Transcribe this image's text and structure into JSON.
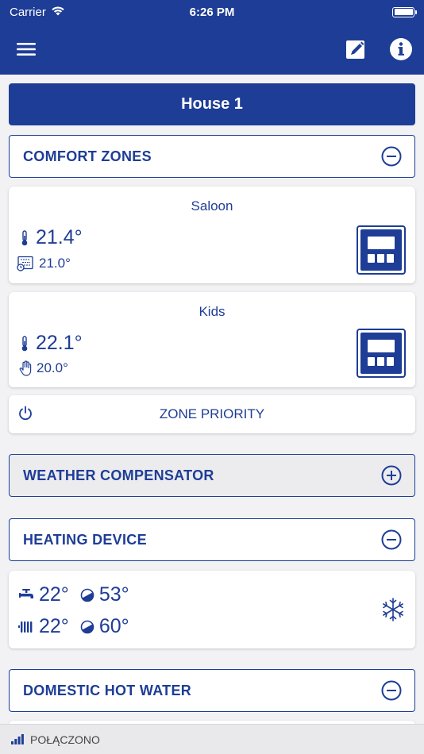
{
  "status_bar": {
    "carrier": "Carrier",
    "time": "6:26 PM"
  },
  "colors": {
    "primary": "#1e3d96",
    "background": "#f2f2f4",
    "card": "#ffffff"
  },
  "house": {
    "title": "House 1"
  },
  "comfort_zones": {
    "label": "COMFORT ZONES",
    "expanded": true,
    "zones": [
      {
        "name": "Saloon",
        "temperature": "21.4°",
        "setpoint": "21.0°",
        "mode_icon": "schedule-icon"
      },
      {
        "name": "Kids",
        "temperature": "22.1°",
        "setpoint": "20.0°",
        "mode_icon": "hand-icon"
      }
    ],
    "priority_label": "ZONE PRIORITY"
  },
  "weather_compensator": {
    "label": "WEATHER COMPENSATOR",
    "expanded": false
  },
  "heating_device": {
    "label": "HEATING DEVICE",
    "expanded": true,
    "dhw_temp": "22°",
    "dhw_setpoint": "53°",
    "ch_temp": "22°",
    "ch_setpoint": "60°",
    "mode_icon": "snowflake-icon"
  },
  "domestic_hot_water": {
    "label": "DOMESTIC HOT WATER",
    "expanded": true
  },
  "footer": {
    "connection_status": "POŁĄCZONO"
  }
}
